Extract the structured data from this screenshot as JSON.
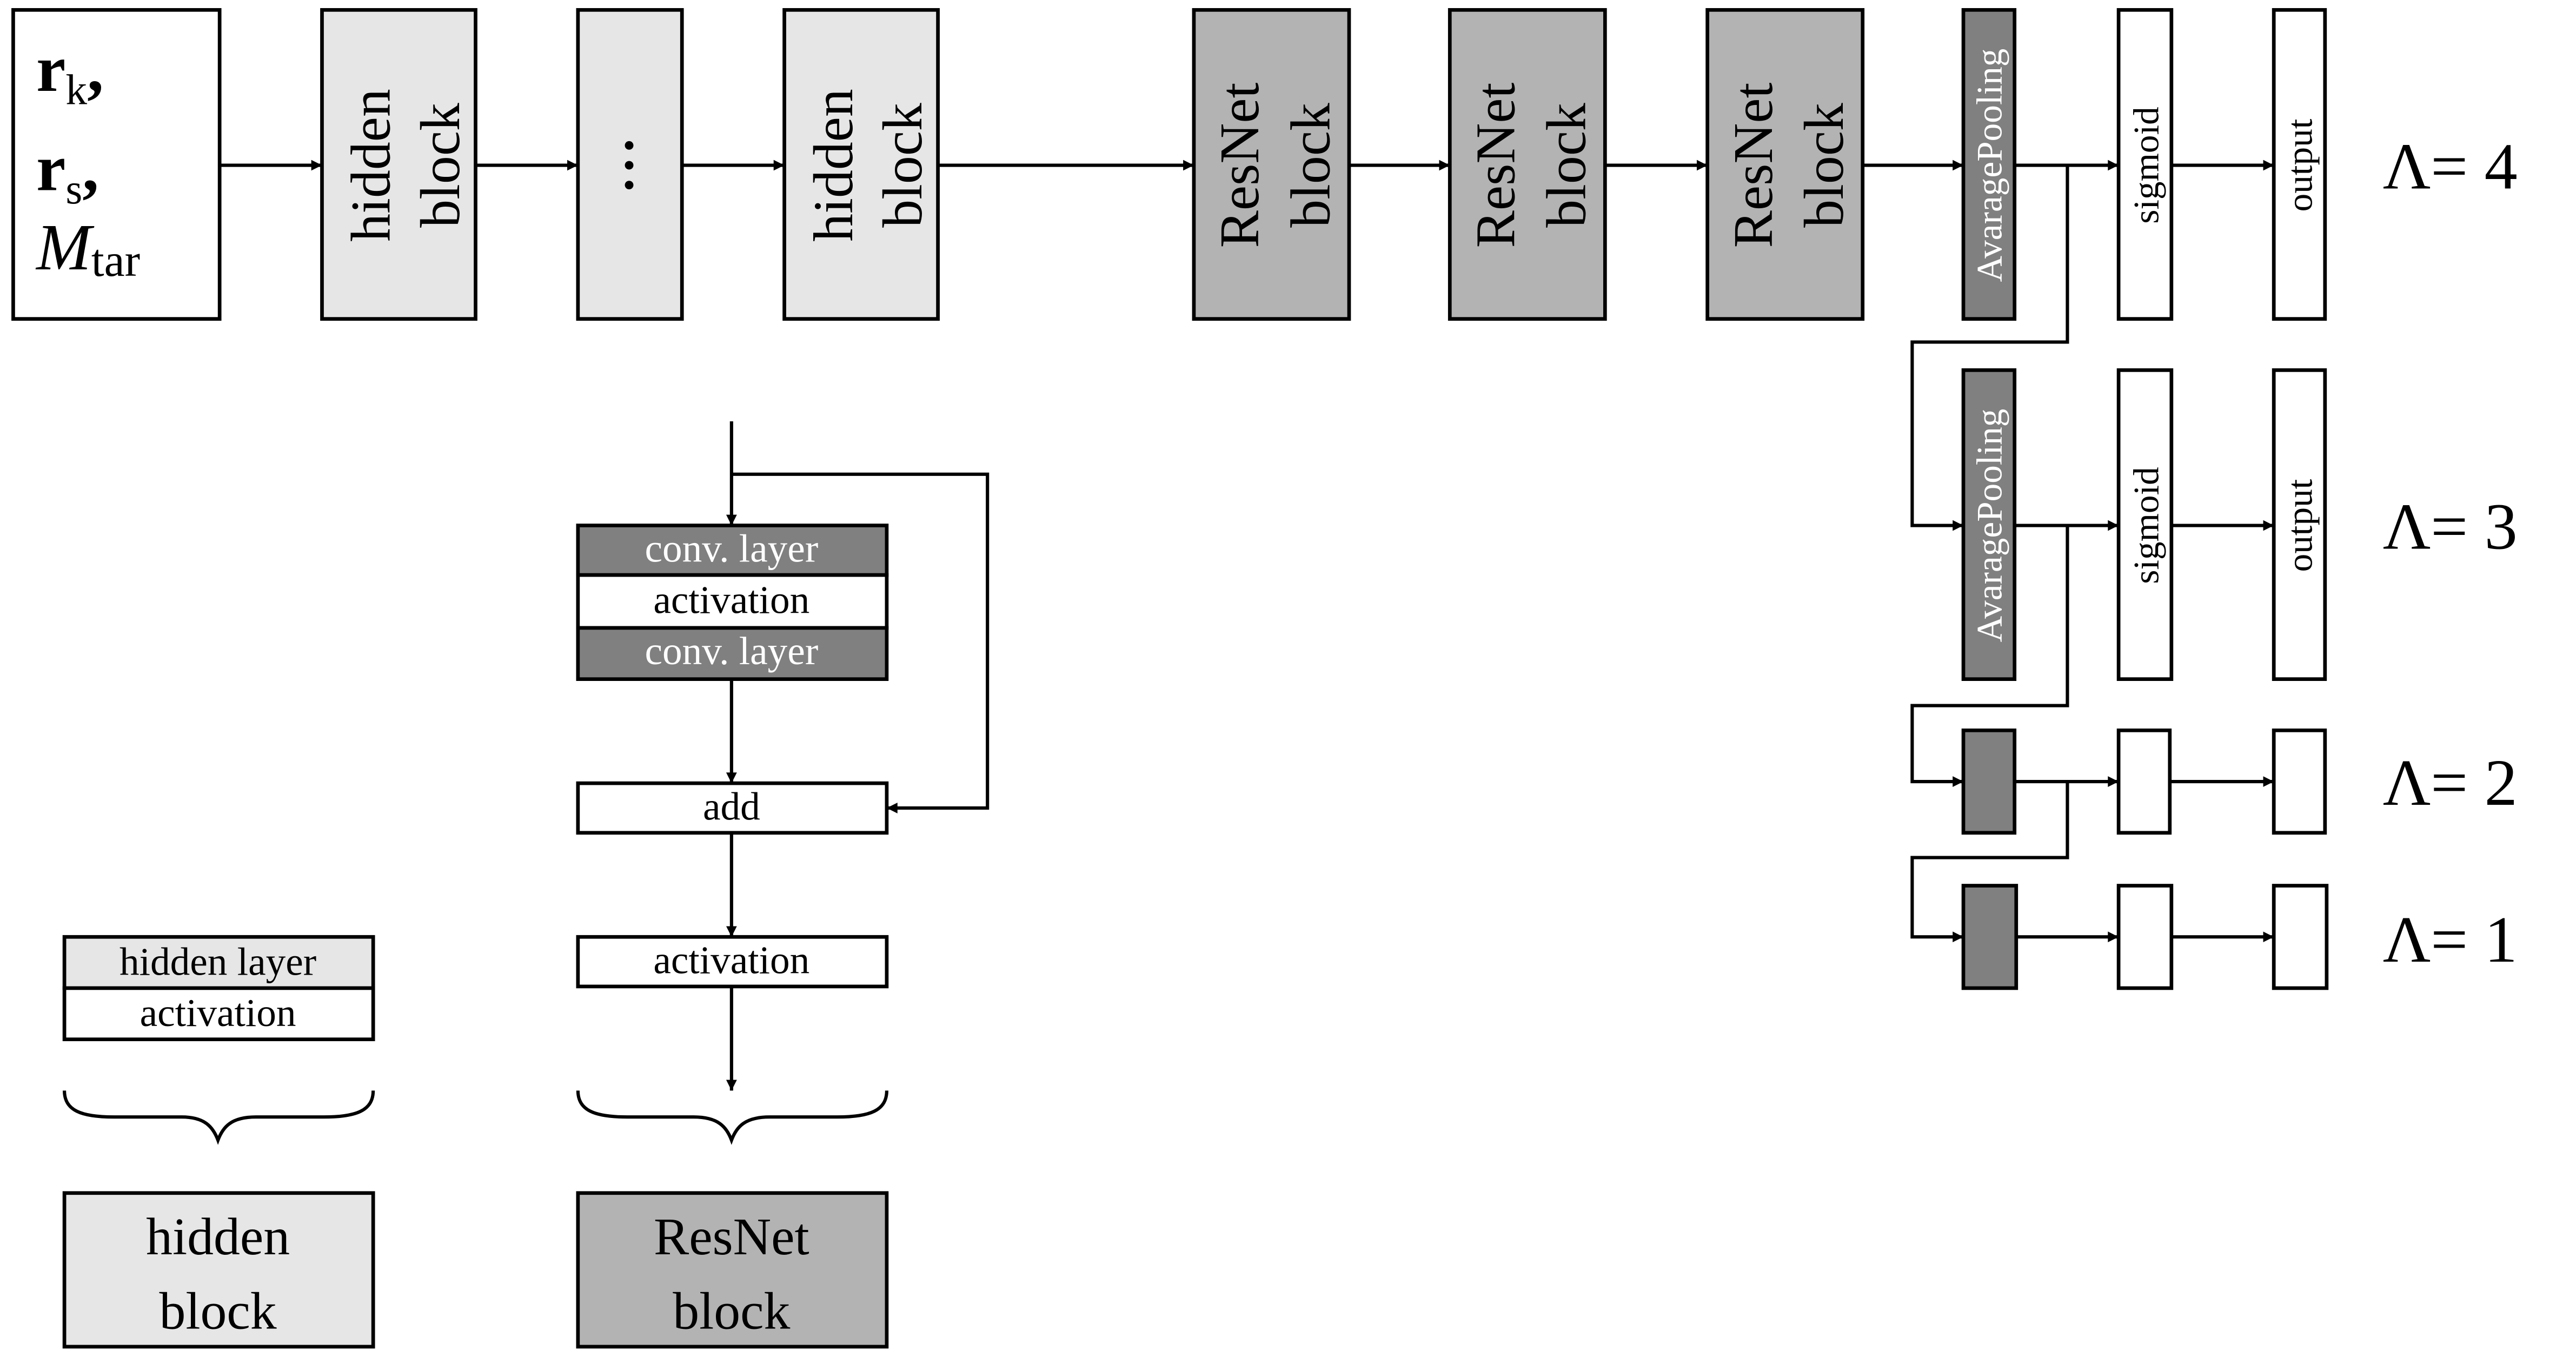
{
  "diagram": {
    "input": {
      "lines": [
        {
          "main": "r",
          "sub": "k",
          "suffix": ","
        },
        {
          "main": "r",
          "sub": "s",
          "suffix": ","
        },
        {
          "main": "M",
          "sub": "tar",
          "suffix": ""
        }
      ]
    },
    "main_chain": [
      {
        "id": "hidden-1",
        "type": "hidden",
        "line1": "hidden",
        "line2": "block"
      },
      {
        "id": "ellipsis",
        "type": "hidden",
        "line1": "⋮",
        "line2": ""
      },
      {
        "id": "hidden-2",
        "type": "hidden",
        "line1": "hidden",
        "line2": "block"
      },
      {
        "id": "resnet-1",
        "type": "resnet",
        "line1": "ResNet",
        "line2": "block"
      },
      {
        "id": "resnet-2",
        "type": "resnet",
        "line1": "ResNet",
        "line2": "block"
      },
      {
        "id": "resnet-3",
        "type": "resnet",
        "line1": "ResNet",
        "line2": "block"
      }
    ],
    "heads": [
      {
        "lambda_label": "Λ= 4",
        "pooling_label": "AvaragePooling",
        "sigmoid_label": "sigmoid",
        "output_label": "output"
      },
      {
        "lambda_label": "Λ= 3",
        "pooling_label": "AvaragePooling",
        "sigmoid_label": "sigmoid",
        "output_label": "output"
      },
      {
        "lambda_label": "Λ= 2",
        "pooling_label": "",
        "sigmoid_label": "",
        "output_label": ""
      },
      {
        "lambda_label": "Λ= 1",
        "pooling_label": "",
        "sigmoid_label": "",
        "output_label": ""
      }
    ],
    "resnet_detail": {
      "conv1": "conv. layer",
      "activation1": "activation",
      "conv2": "conv. layer",
      "add": "add",
      "activation2": "activation",
      "legend_line1": "ResNet",
      "legend_line2": "block"
    },
    "hidden_detail": {
      "hidden_layer": "hidden layer",
      "activation": "activation",
      "legend_line1": "hidden",
      "legend_line2": "block"
    },
    "colors": {
      "hidden_fill": "#e6e6e6",
      "resnet_fill": "#b3b3b3",
      "pooling_fill": "#808080",
      "conv_fill": "#808080",
      "plain_fill": "#ffffff",
      "stroke": "#000000"
    }
  }
}
